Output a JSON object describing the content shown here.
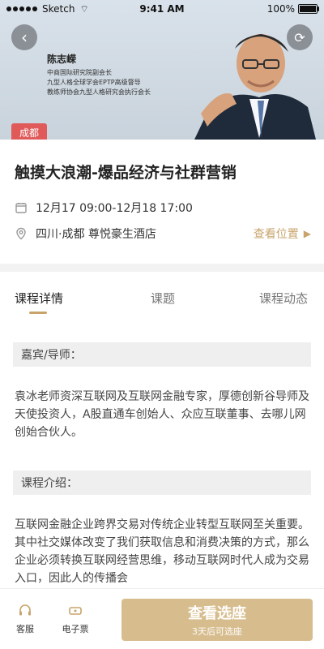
{
  "status_bar": {
    "carrier": "Sketch",
    "time": "9:41 AM",
    "battery": "100%"
  },
  "hero": {
    "speaker_name": "陈志嵘",
    "speaker_titles": [
      "中商国际研究院副会长",
      "九型人格全球学会EPTP高级督导",
      "教练师协会九型人格研究会执行会长"
    ],
    "city": "成都"
  },
  "event": {
    "title": "触摸大浪潮-爆品经济与社群营销",
    "date_range": "12月17 09:00-12月18 17:00",
    "location": "四川·成都  尊悦豪生酒店",
    "view_location": "查看位置"
  },
  "tabs": {
    "course_detail": "课程详情",
    "topic": "课题",
    "course_news": "课程动态"
  },
  "content": {
    "guest_header": "嘉宾/导师：",
    "guest_text": "袁冰老师资深互联网及互联网金融专家，厚德创新谷导师及天使投资人，A股直通车创始人、众应互联董事、去哪儿网创始合伙人。",
    "intro_header": "课程介绍：",
    "intro_text": "互联网金融企业跨界交易对传统企业转型互联网至关重要。其中社交媒体改变了我们获取信息和消费决策的方式，那么企业必须转换互联网经营思维，移动互联网时代人成为交易入口，因此人的传播会"
  },
  "bottom_bar": {
    "customer_service": "客服",
    "e_ticket": "电子票",
    "cta_main": "查看选座",
    "cta_sub": "3天后可选座"
  },
  "icons": {
    "back": "chevron-left-icon",
    "share": "share-icon",
    "calendar": "calendar-icon",
    "location": "location-pin-icon",
    "arrow": "triangle-right-icon",
    "headset": "headset-icon",
    "ticket": "ticket-icon"
  },
  "colors": {
    "accent_gold": "#c8a46c",
    "cta_bg": "#d7bd8e",
    "badge_red": "#e05a5a"
  }
}
